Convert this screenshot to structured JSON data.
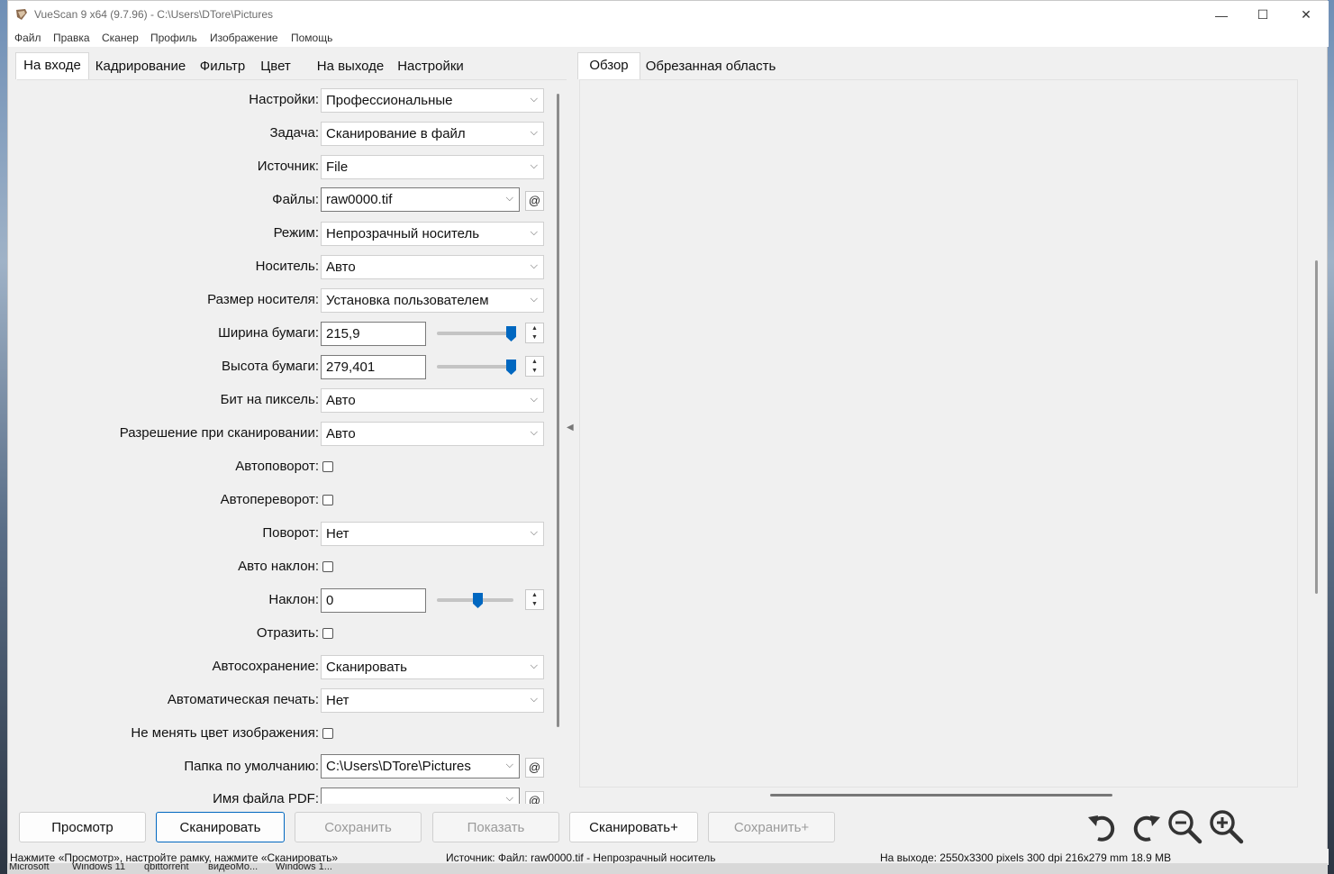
{
  "window": {
    "title": "VueScan 9 x64 (9.7.96) - C:\\Users\\DTore\\Pictures",
    "minimize_glyph": "—",
    "maximize_glyph": "☐",
    "close_glyph": "✕"
  },
  "menu": [
    "Файл",
    "Правка",
    "Сканер",
    "Профиль",
    "Изображение",
    "Помощь"
  ],
  "left_tabs": [
    "На входе",
    "Кадрирование",
    "Фильтр",
    "Цвет",
    "На выходе",
    "Настройки"
  ],
  "right_tabs": [
    "Обзор",
    "Обрезанная область"
  ],
  "form": {
    "settings_label": "Настройки:",
    "settings_value": "Профессиональные",
    "task_label": "Задача:",
    "task_value": "Сканирование в файл",
    "source_label": "Источник:",
    "source_value": "File",
    "files_label": "Файлы:",
    "files_value": "raw0000.tif",
    "mode_label": "Режим:",
    "mode_value": "Непрозрачный носитель",
    "media_label": "Носитель:",
    "media_value": "Авто",
    "media_size_label": "Размер носителя:",
    "media_size_value": "Установка пользователем",
    "paper_width_label": "Ширина бумаги:",
    "paper_width_value": "215,9",
    "paper_height_label": "Высота бумаги:",
    "paper_height_value": "279,401",
    "bits_label": "Бит на пиксель:",
    "bits_value": "Авто",
    "resolution_label": "Разрешение при сканировании:",
    "resolution_value": "Авто",
    "autorotate_label": "Автоповорот:",
    "autoflip_label": "Автопереворот:",
    "rotate_label": "Поворот:",
    "rotate_value": "Нет",
    "autoskew_label": "Авто наклон:",
    "skew_label": "Наклон:",
    "skew_value": "0",
    "mirror_label": "Отразить:",
    "autosave_label": "Автосохранение:",
    "autosave_value": "Сканировать",
    "autoprint_label": "Автоматическая печать:",
    "autoprint_value": "Нет",
    "keep_color_label": "Не менять цвет изображения:",
    "default_folder_label": "Папка по умолчанию:",
    "default_folder_value": "C:\\Users\\DTore\\Pictures",
    "pdf_name_label": "Имя файла PDF:",
    "at_symbol": "@",
    "chevron": "⌵",
    "spin_up": "▲",
    "spin_down": "▼"
  },
  "slider_levels": {
    "paper_width": 1.0,
    "paper_height": 1.0,
    "skew": 0.5
  },
  "buttons": {
    "preview": "Просмотр",
    "scan": "Сканировать",
    "save": "Сохранить",
    "show": "Показать",
    "scan_plus": "Сканировать+",
    "save_plus": "Сохранить+"
  },
  "status": {
    "hint": "Нажмите «Просмотр», настройте рамку, нажмите «Сканировать»",
    "input": "Источник: Файл: raw0000.tif - Непрозрачный носитель",
    "output": "На выходе: 2550x3300 pixels 300 dpi 216x279 mm 18.9 MB"
  },
  "taskbar": [
    "Microsoft",
    "Windows 11",
    "qbittorrent",
    "видеоМо...",
    "Windows 1..."
  ],
  "collapse_glyph": "◀",
  "colors": {
    "accent": "#0067c0",
    "window_bg": "#f0f0f0",
    "tab_active_bg": "#ffffff"
  }
}
